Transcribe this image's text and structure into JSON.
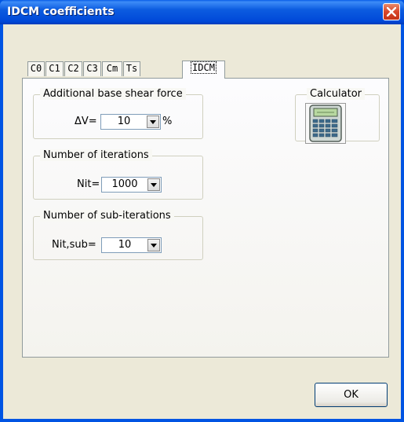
{
  "window": {
    "title": "IDCM coefficients"
  },
  "tabs": [
    {
      "label": "C0"
    },
    {
      "label": "C1"
    },
    {
      "label": "C2"
    },
    {
      "label": "C3"
    },
    {
      "label": "Cm"
    },
    {
      "label": "Ts"
    },
    {
      "label": "IDCM",
      "active": true
    }
  ],
  "groups": {
    "base_shear": {
      "legend": "Additional base shear force",
      "label": "ΔV=",
      "value": "10",
      "unit": "%"
    },
    "iterations": {
      "legend": "Number of iterations",
      "label": "Nit=",
      "value": "1000"
    },
    "sub_iterations": {
      "legend": "Number of sub-iterations",
      "label": "Nit,sub=",
      "value": "10"
    },
    "calculator": {
      "legend": "Calculator",
      "icon": "calculator-icon"
    }
  },
  "buttons": {
    "ok": "OK"
  },
  "icons": {
    "close": "close-icon",
    "dropdown": "chevron-down-icon"
  },
  "colors": {
    "titlebar": "#0054e3",
    "face": "#ece9d8",
    "close": "#d8462a"
  }
}
